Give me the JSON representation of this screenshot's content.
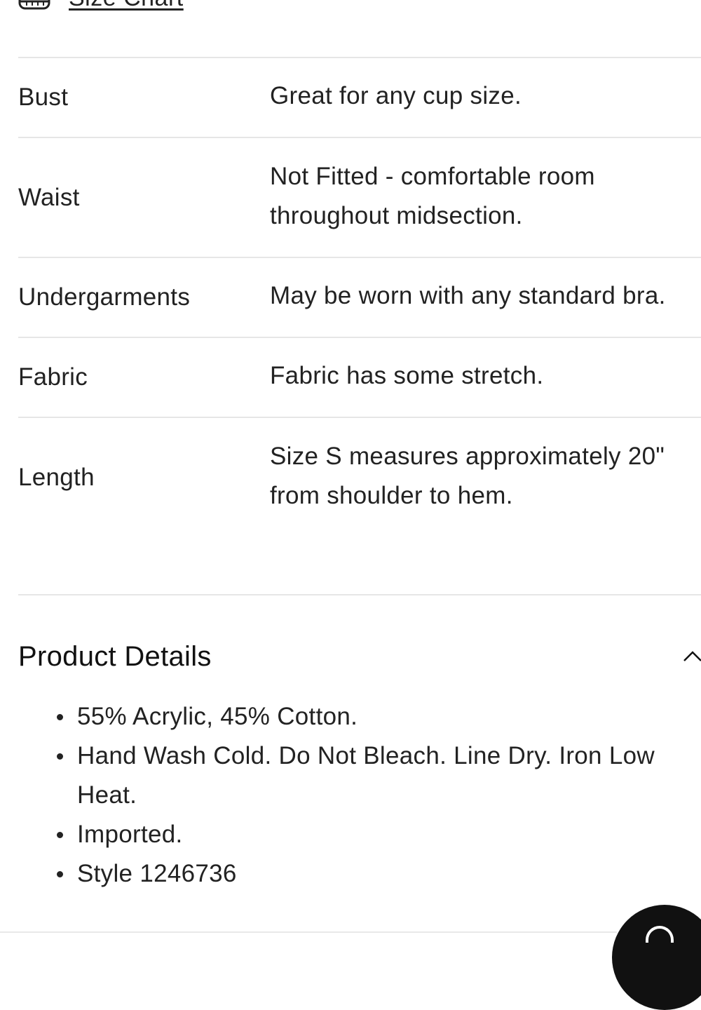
{
  "size_chart": {
    "label": "Size Chart",
    "icon": "ruler-icon"
  },
  "fit_rows": [
    {
      "key": "Bust",
      "value": "Great for any cup size."
    },
    {
      "key": "Waist",
      "value": "Not Fitted - comfortable room\nthroughout midsection."
    },
    {
      "key": "Undergarments",
      "value": "May be worn with any standard bra."
    },
    {
      "key": "Fabric",
      "value": "Fabric has some stretch."
    },
    {
      "key": "Length",
      "value": "Size S measures approximately 20\"\nfrom shoulder to hem."
    }
  ],
  "product_details": {
    "title": "Product Details",
    "toggle_icon": "chevron-up-icon",
    "items": [
      "55% Acrylic, 45% Cotton.",
      "Hand Wash Cold. Do Not Bleach. Line Dry. Iron Low Heat.",
      "Imported.",
      "Style 1246736"
    ]
  },
  "chat": {
    "icon": "chat-icon"
  }
}
